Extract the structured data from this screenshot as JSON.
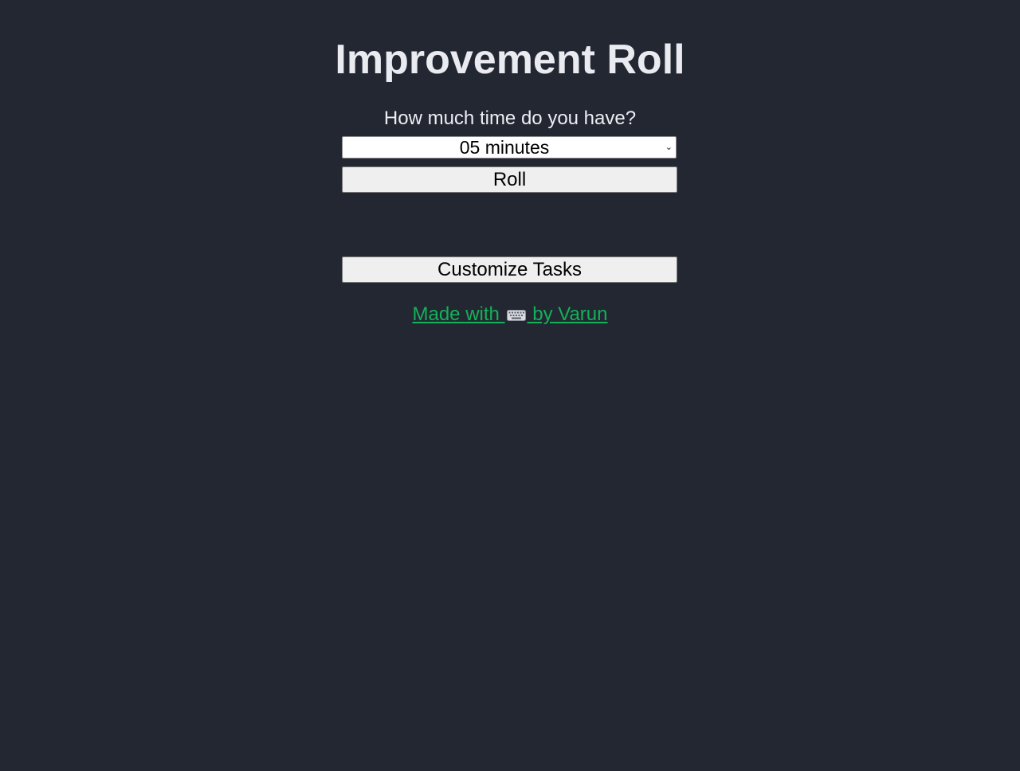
{
  "app": {
    "title": "Improvement Roll",
    "prompt": "How much time do you have?"
  },
  "time_select": {
    "selected": "05 minutes"
  },
  "buttons": {
    "roll_label": "Roll",
    "customize_label": "Customize Tasks"
  },
  "footer": {
    "prefix": "Made with ",
    "icon": "keyboard-icon",
    "suffix": " by Varun"
  },
  "colors": {
    "background": "#232731",
    "link": "#13b15a"
  }
}
